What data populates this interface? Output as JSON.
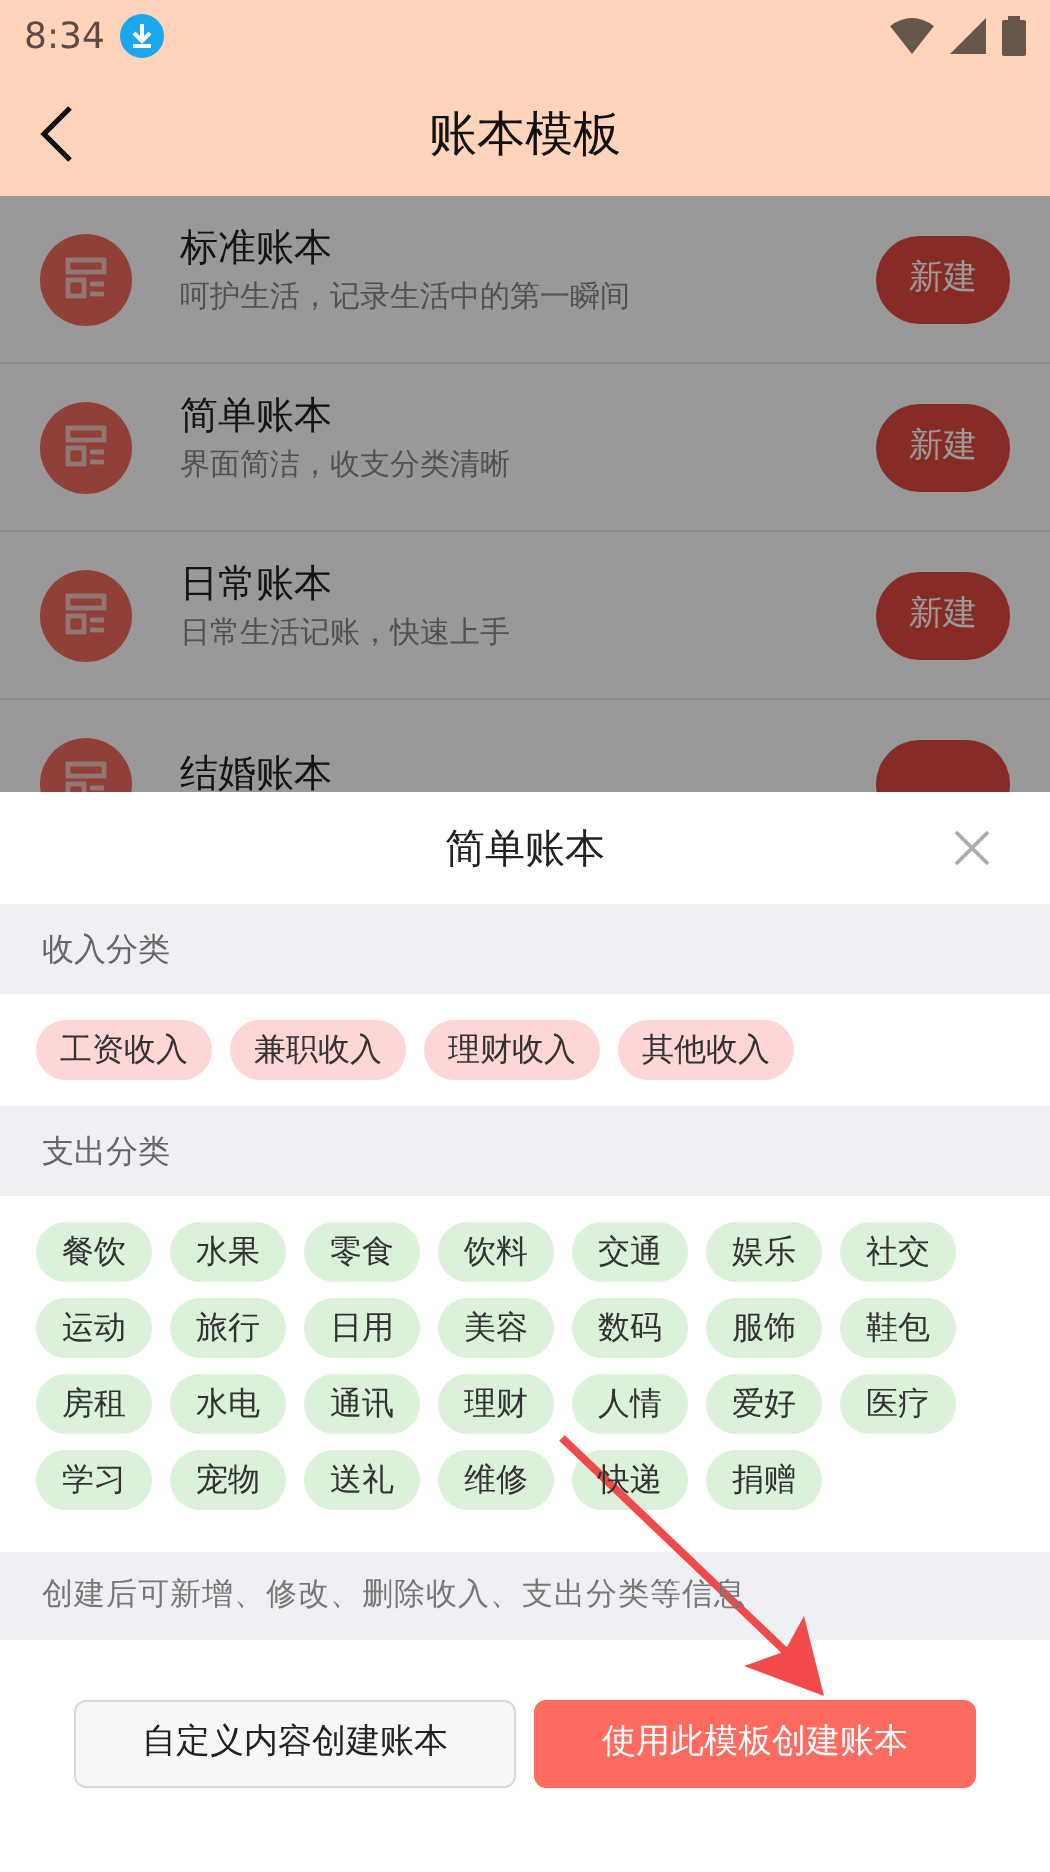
{
  "status_bar": {
    "time": "8:34"
  },
  "header": {
    "title": "账本模板"
  },
  "templates": [
    {
      "name": "标准账本",
      "description": "呵护生活，记录生活中的第一瞬间",
      "button": "新建"
    },
    {
      "name": "简单账本",
      "description": "界面简洁，收支分类清晰",
      "button": "新建"
    },
    {
      "name": "日常账本",
      "description": "日常生活记账，快速上手",
      "button": "新建"
    },
    {
      "name": "结婚账本"
    }
  ],
  "sheet": {
    "title": "简单账本",
    "sections": [
      {
        "title": "收入分类",
        "kind": "income",
        "tags": [
          "工资收入",
          "兼职收入",
          "理财收入",
          "其他收入"
        ]
      },
      {
        "title": "支出分类",
        "kind": "expense",
        "tags": [
          "餐饮",
          "水果",
          "零食",
          "饮料",
          "交通",
          "娱乐",
          "社交",
          "运动",
          "旅行",
          "日用",
          "美容",
          "数码",
          "服饰",
          "鞋包",
          "房租",
          "水电",
          "通讯",
          "理财",
          "人情",
          "爱好",
          "医疗",
          "学习",
          "宠物",
          "送礼",
          "维修",
          "快递",
          "捐赠"
        ]
      }
    ],
    "note": "创建后可新增、修改、删除收入、支出分类等信息",
    "buttons": [
      {
        "label": "自定义内容创建账本",
        "kind": "secondary"
      },
      {
        "label": "使用此模板创建账本",
        "kind": "primary"
      }
    ]
  }
}
